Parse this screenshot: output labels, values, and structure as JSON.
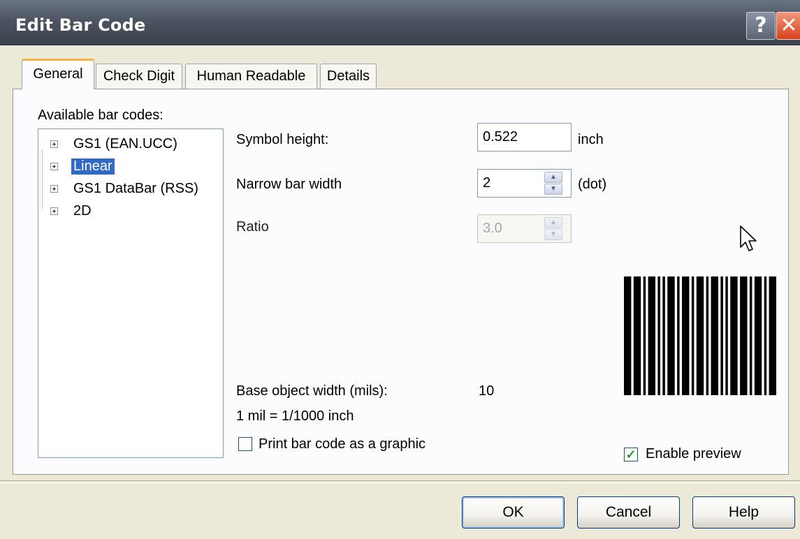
{
  "window": {
    "title": "Edit Bar Code",
    "help_glyph": "?",
    "close_glyph": "✕"
  },
  "tabs": [
    {
      "label": "General"
    },
    {
      "label": "Check Digit"
    },
    {
      "label": "Human Readable"
    },
    {
      "label": "Details"
    }
  ],
  "general": {
    "available_label": "Available bar codes:",
    "tree": [
      {
        "label": "GS1 (EAN.UCC)",
        "selected": false
      },
      {
        "label": "Linear",
        "selected": true
      },
      {
        "label": "GS1 DataBar (RSS)",
        "selected": false
      },
      {
        "label": "2D",
        "selected": false
      }
    ],
    "symbol_height": {
      "label": "Symbol height:",
      "value": "0.522",
      "unit": "inch"
    },
    "narrow_bar_width": {
      "label": "Narrow bar width",
      "value": "2",
      "unit": "(dot)"
    },
    "ratio": {
      "label": "Ratio",
      "value": "3.0"
    },
    "base_object_width": {
      "label": "Base object width (mils):",
      "value": "10"
    },
    "mil_note": "1 mil = 1/1000 inch",
    "print_as_graphic": {
      "label": "Print bar code as a graphic",
      "checked": false
    },
    "enable_preview": {
      "label": "Enable preview",
      "checked": true
    }
  },
  "buttons": {
    "ok": "OK",
    "cancel": "Cancel",
    "help": "Help"
  },
  "icons": {
    "help": "help-icon",
    "close": "close-icon",
    "expand": "plus-expand-icon",
    "checkmark": "checkmark-icon",
    "spin_up": "spin-up-icon",
    "spin_down": "spin-down-icon",
    "cursor": "mouse-cursor-icon"
  },
  "colors": {
    "titlebar": "#4d5563",
    "selection": "#316ac5",
    "tab_accent": "#f6b23a",
    "close_button": "#d8401c",
    "checkmark": "#21a121"
  }
}
